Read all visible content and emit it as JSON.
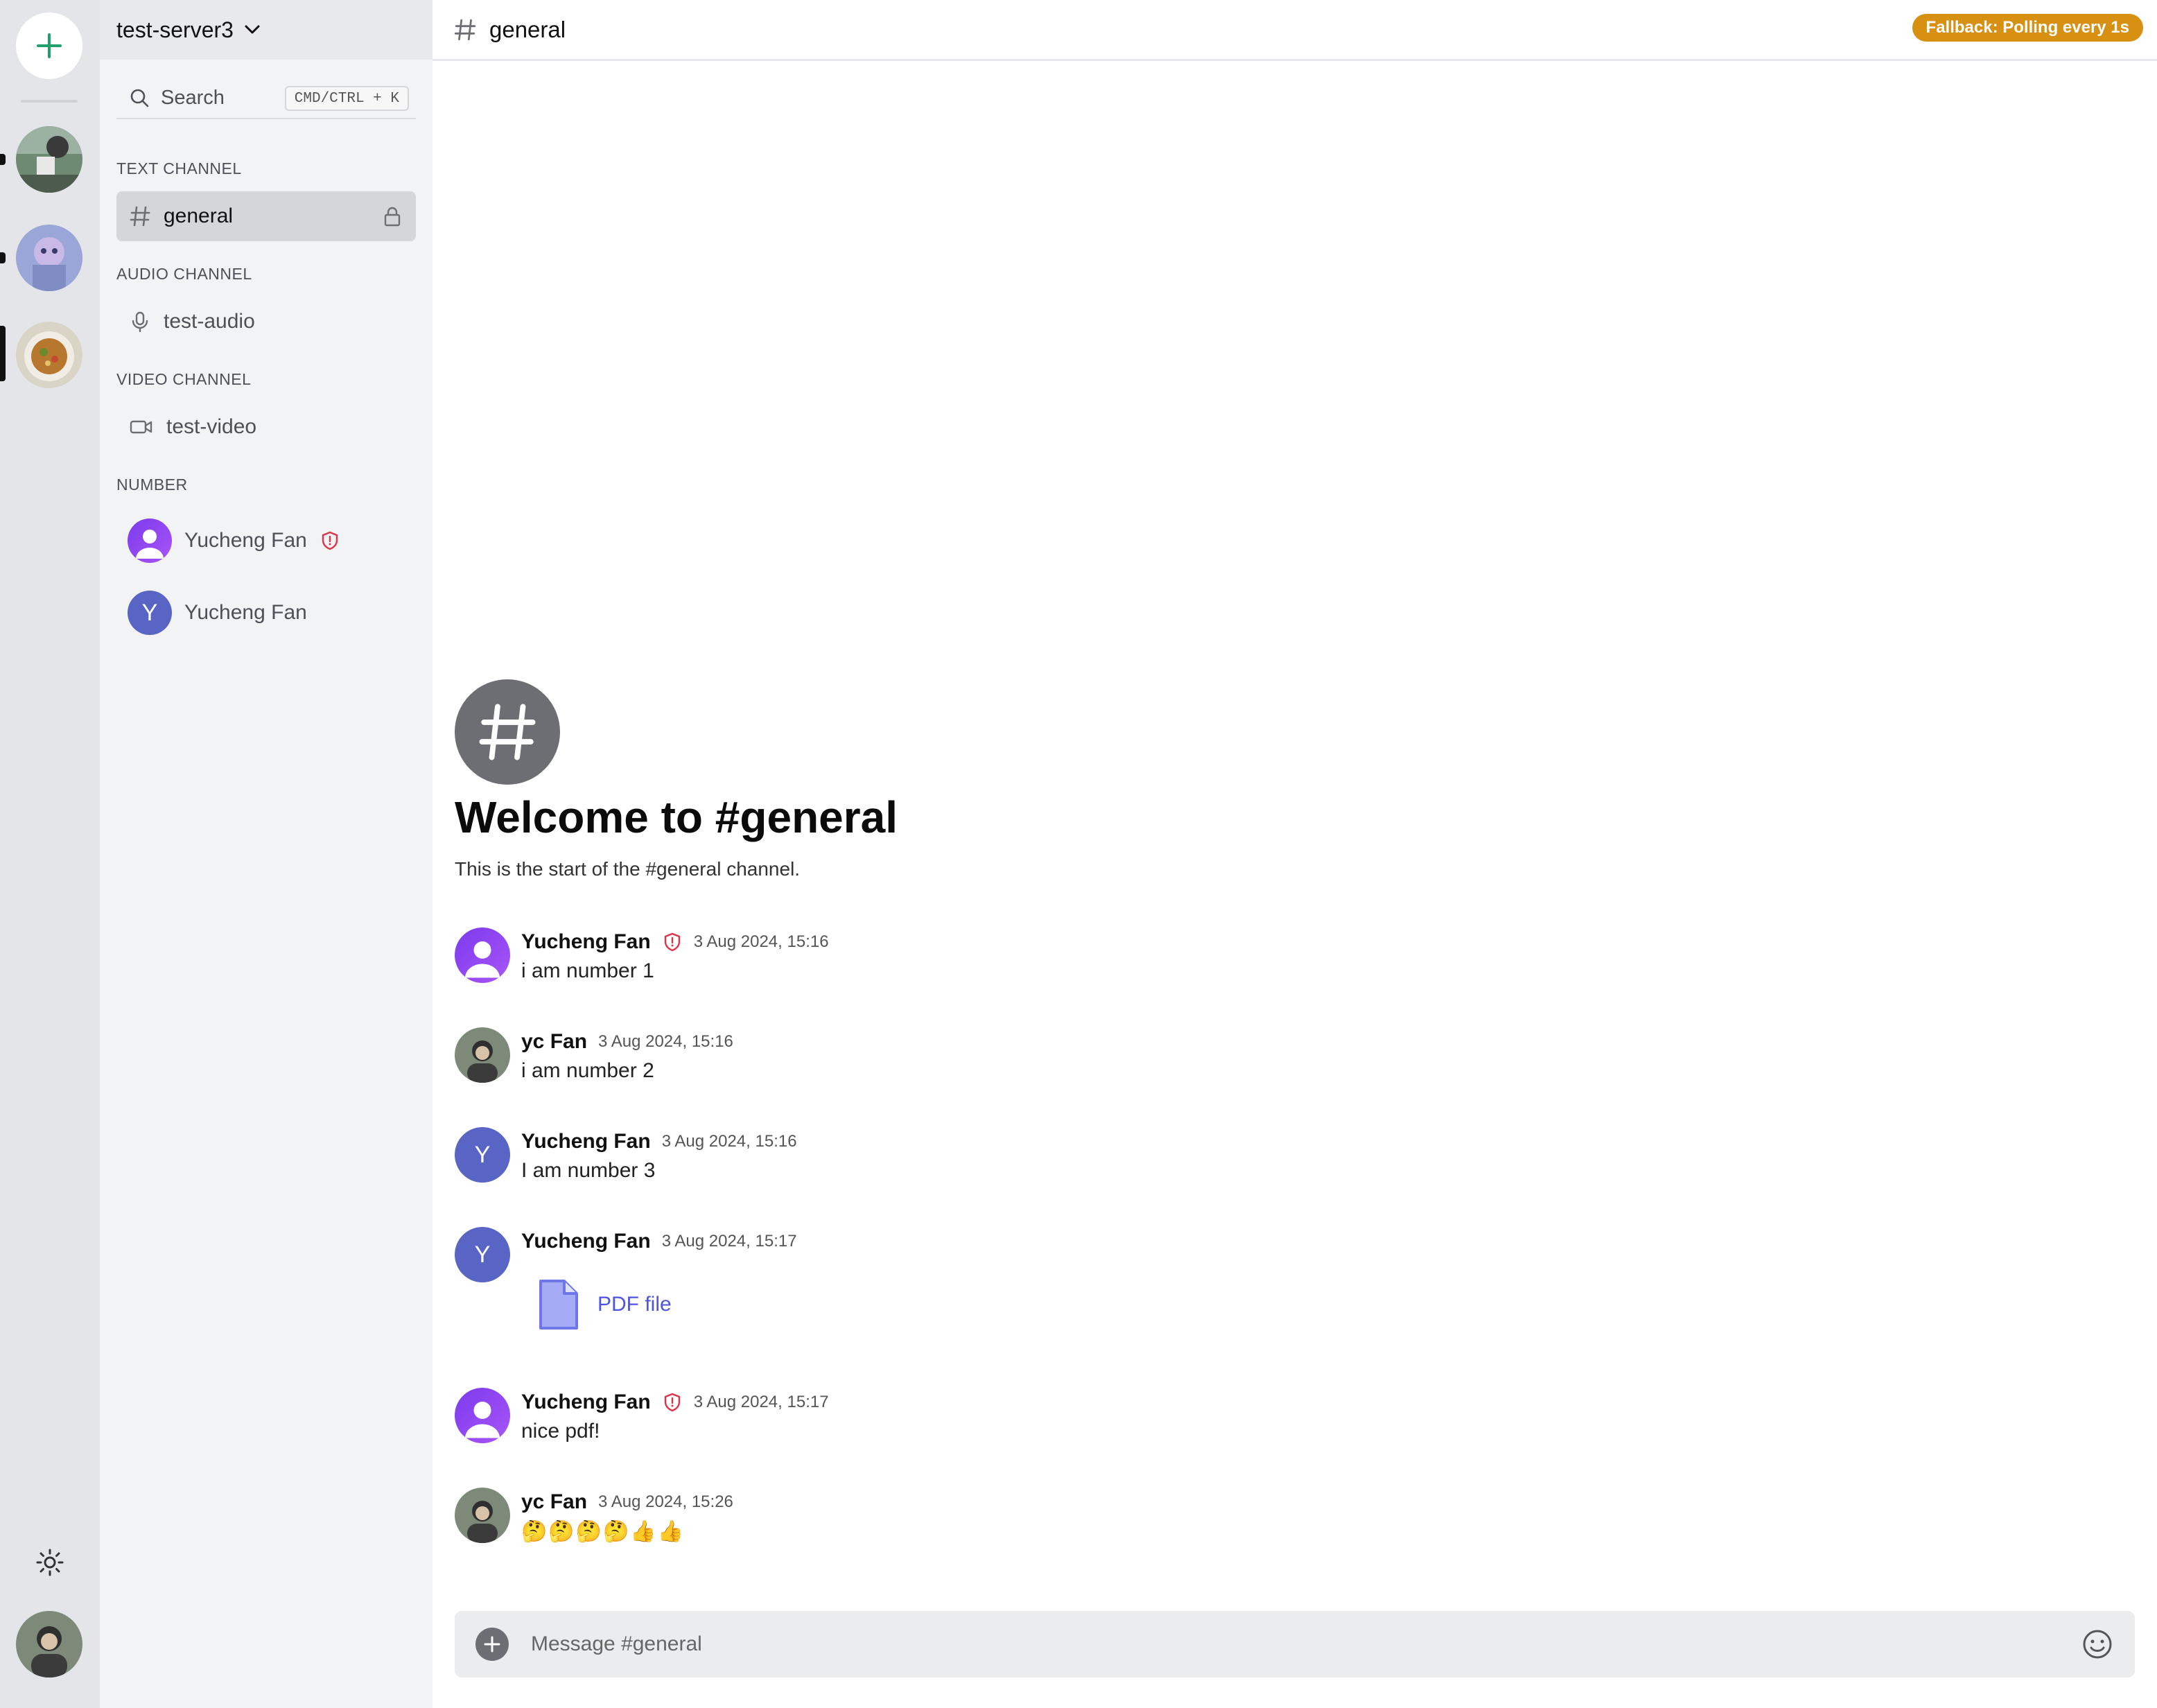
{
  "server": {
    "name": "test-server3"
  },
  "search": {
    "label": "Search",
    "shortcut": "CMD/CTRL + K"
  },
  "sections": {
    "text": "TEXT CHANNEL",
    "audio": "AUDIO CHANNEL",
    "video": "VIDEO CHANNEL",
    "members": "NUMBER"
  },
  "channels": {
    "text": "general",
    "audio": "test-audio",
    "video": "test-video"
  },
  "members": [
    {
      "name": "Yucheng Fan",
      "role": "admin"
    },
    {
      "name": "Yucheng Fan",
      "initial": "Y"
    }
  ],
  "header": {
    "channel": "general",
    "badge": "Fallback: Polling every 1s"
  },
  "welcome": {
    "title": "Welcome to #general",
    "subtitle": "This is the start of the #general channel."
  },
  "messages": [
    {
      "author": "Yucheng Fan",
      "time": "3 Aug 2024, 15:16",
      "text": "i am number 1"
    },
    {
      "author": "yc Fan",
      "time": "3 Aug 2024, 15:16",
      "text": "i am number 2"
    },
    {
      "author": "Yucheng Fan",
      "time": "3 Aug 2024, 15:16",
      "text": "I am number 3",
      "initial": "Y"
    },
    {
      "author": "Yucheng Fan",
      "time": "3 Aug 2024, 15:17",
      "attachment": "PDF file",
      "initial": "Y"
    },
    {
      "author": "Yucheng Fan",
      "time": "3 Aug 2024, 15:17",
      "text": "nice pdf!"
    },
    {
      "author": "yc Fan",
      "time": "3 Aug 2024, 15:26",
      "text": "🤔🤔🤔🤔👍👍"
    }
  ],
  "composer": {
    "placeholder": "Message #general"
  },
  "colors": {
    "accent": "#22a06b",
    "badge": "#d79012",
    "admin_shield": "#e0334a",
    "link": "#4f55e0",
    "avatar_blue": "#5865c5",
    "avatar_purple": "#8b3cf0"
  }
}
